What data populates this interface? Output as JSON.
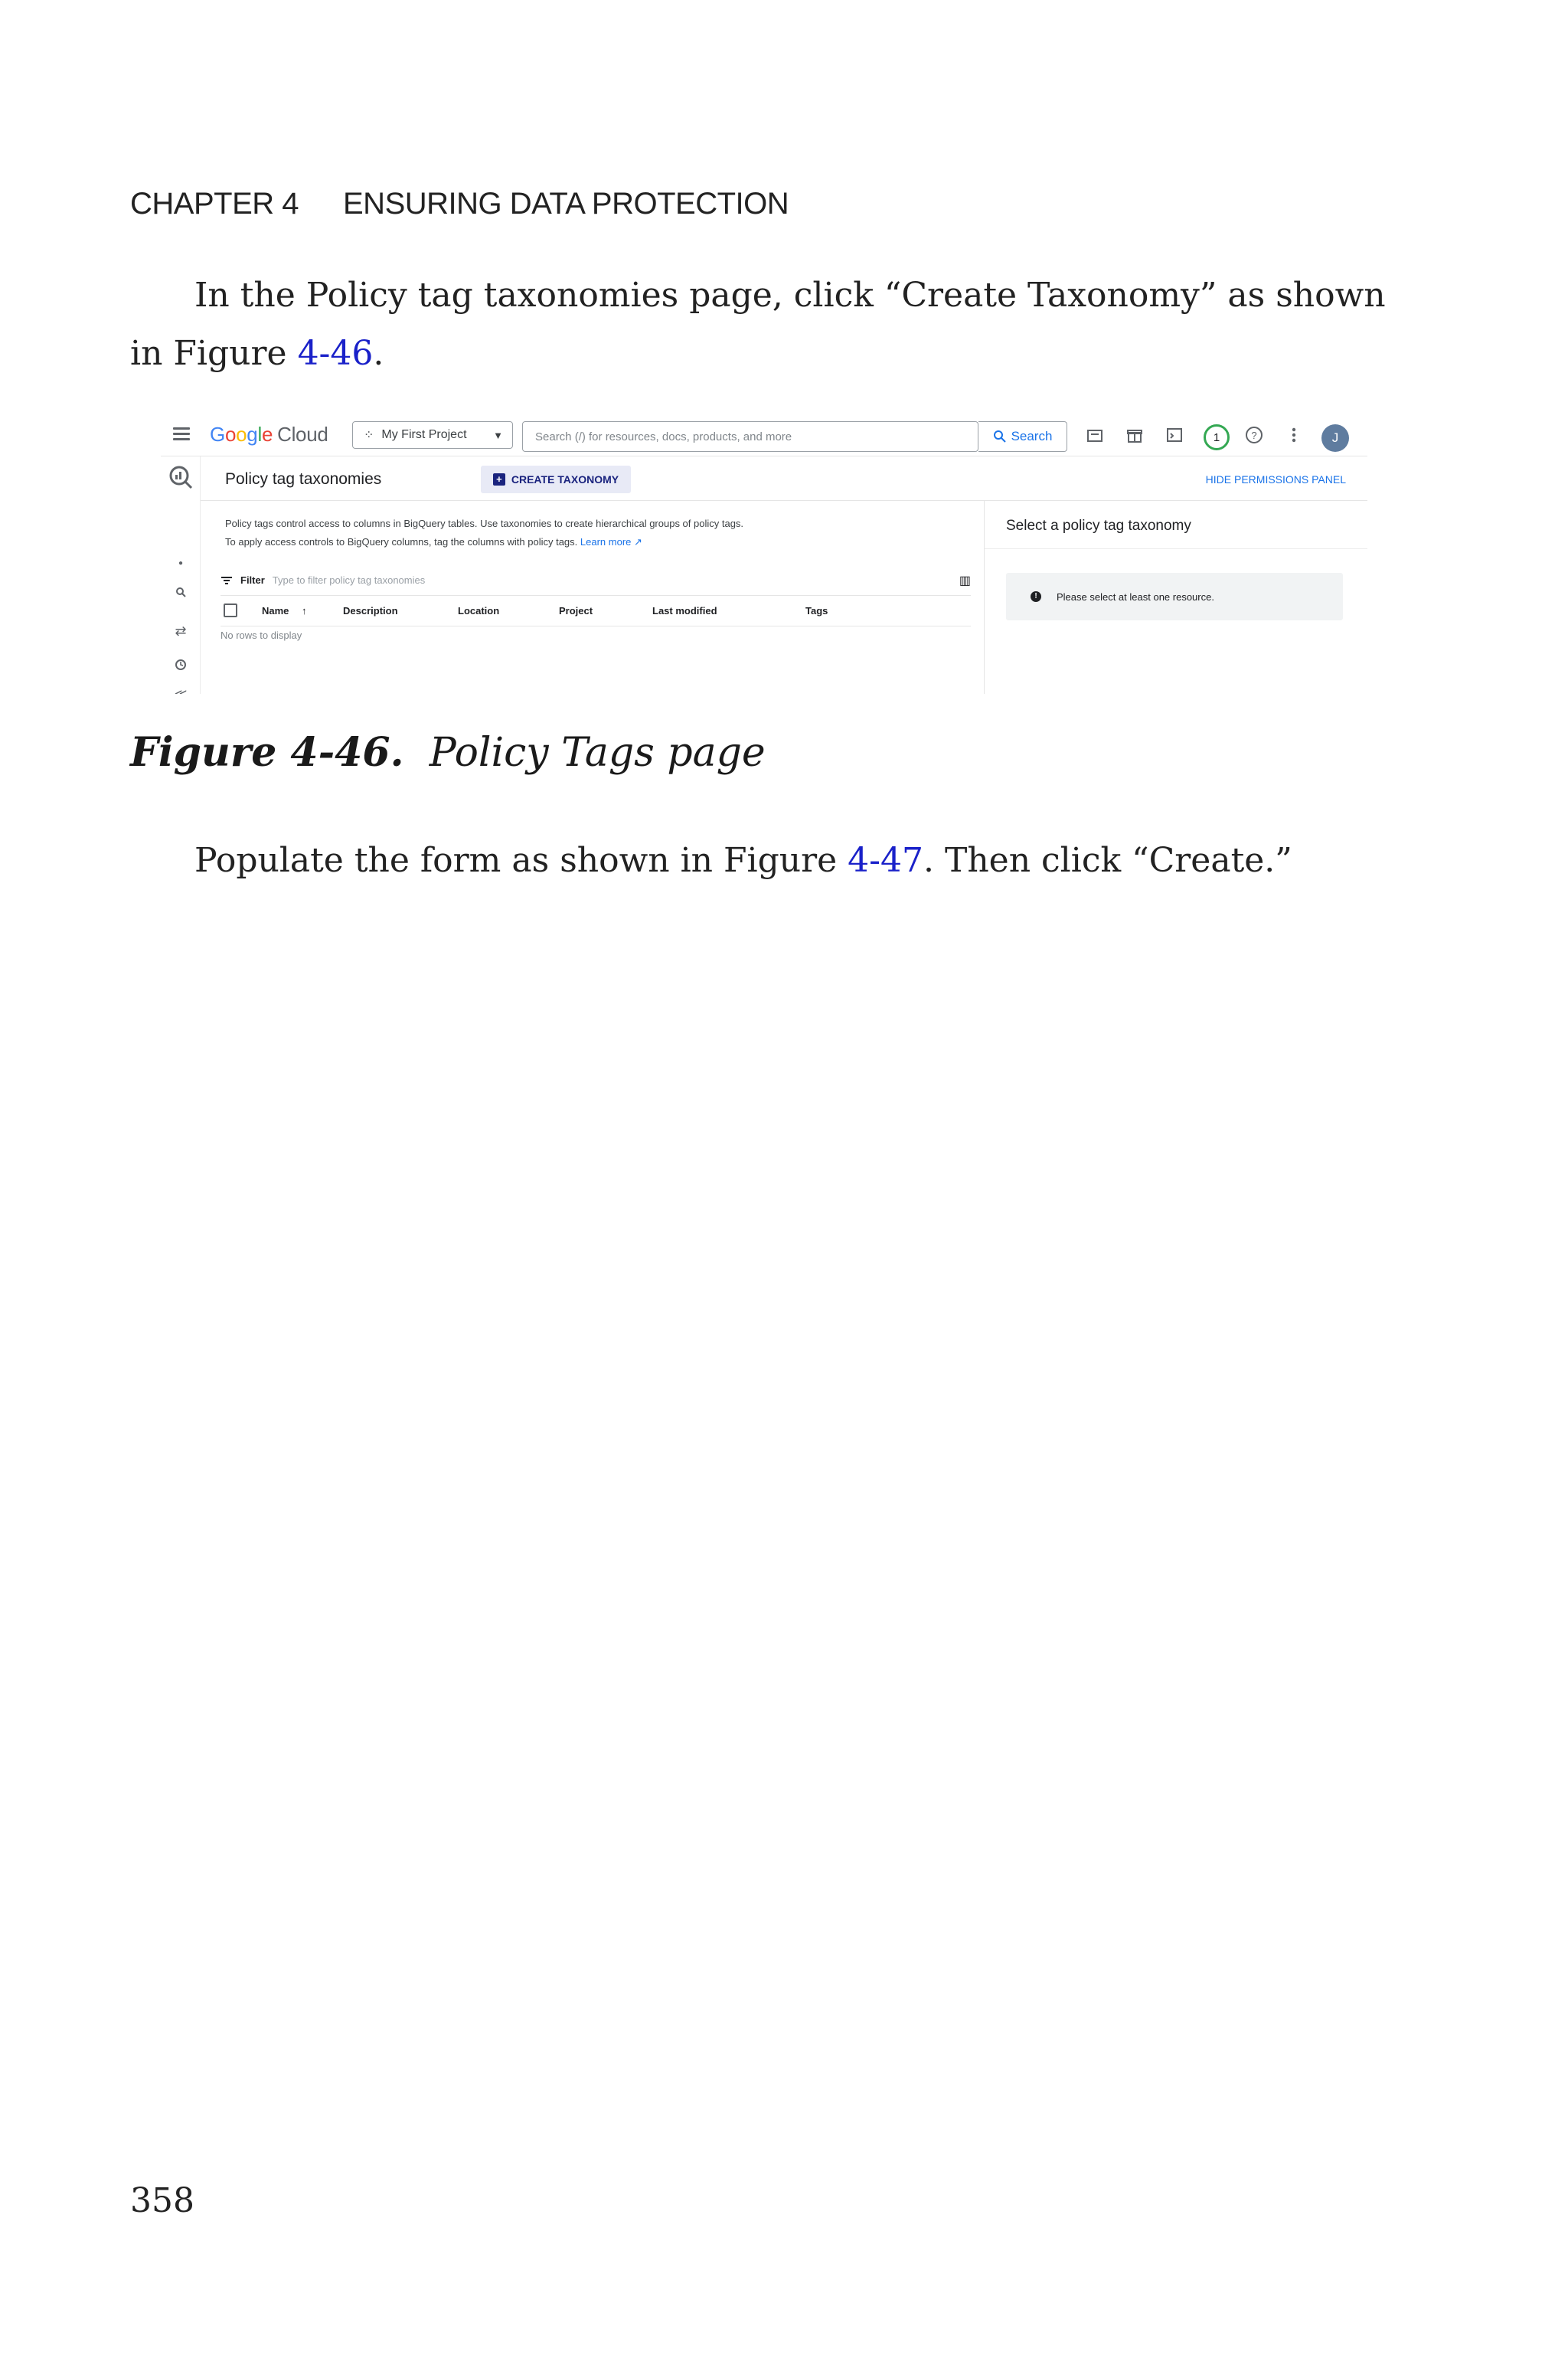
{
  "running_head": {
    "chapter": "CHAPTER 4",
    "title": "ENSURING DATA PROTECTION"
  },
  "paragraph_1": {
    "text_before": "In the Policy tag taxonomies page, click “Create Taxonomy” as shown",
    "line2_prefix": "in Figure ",
    "link": "4-46",
    "line2_suffix": "."
  },
  "screenshot": {
    "topbar": {
      "logo_letters": [
        "G",
        "o",
        "o",
        "g",
        "l",
        "e"
      ],
      "logo_suffix": "Cloud",
      "project_label": "My First Project",
      "search_placeholder": "Search (/) for resources, docs, products, and more",
      "search_button": "Search",
      "notification_count": "1",
      "avatar_initial": "J"
    },
    "page_header": {
      "title": "Policy tag taxonomies",
      "create_button": "CREATE TAXONOMY",
      "hide_panel_link": "HIDE PERMISSIONS PANEL"
    },
    "description": {
      "text": "Policy tags control access to columns in BigQuery tables. Use taxonomies to create hierarchical groups of policy tags. To apply access controls to BigQuery columns, tag the columns with policy tags.",
      "learn_more": "Learn more"
    },
    "filter": {
      "label": "Filter",
      "placeholder": "Type to filter policy tag taxonomies"
    },
    "table": {
      "columns": [
        "Name",
        "Description",
        "Location",
        "Project",
        "Last modified",
        "Tags"
      ],
      "empty_message": "No rows to display"
    },
    "side_panel": {
      "title": "Select a policy tag taxonomy",
      "notice": "Please select at least one resource."
    },
    "icons": [
      "menu-icon",
      "project-picker-icon",
      "search-icon",
      "marketplace-icon",
      "gift-icon",
      "cloud-shell-icon",
      "help-icon",
      "more-vert-icon",
      "bigquery-logo-icon",
      "dot-icon",
      "rail-search-icon",
      "transfer-icon",
      "history-icon",
      "collapse-icon",
      "filter-icon",
      "columns-icon",
      "sort-arrow-icon",
      "info-icon",
      "external-link-icon"
    ]
  },
  "caption": {
    "label": "Figure 4-46.",
    "text": "Policy Tags page"
  },
  "paragraph_2": {
    "text_before": "Populate the form as shown in Figure ",
    "link": "4-47",
    "text_after": ". Then click “Create.”"
  },
  "page_number": "358"
}
